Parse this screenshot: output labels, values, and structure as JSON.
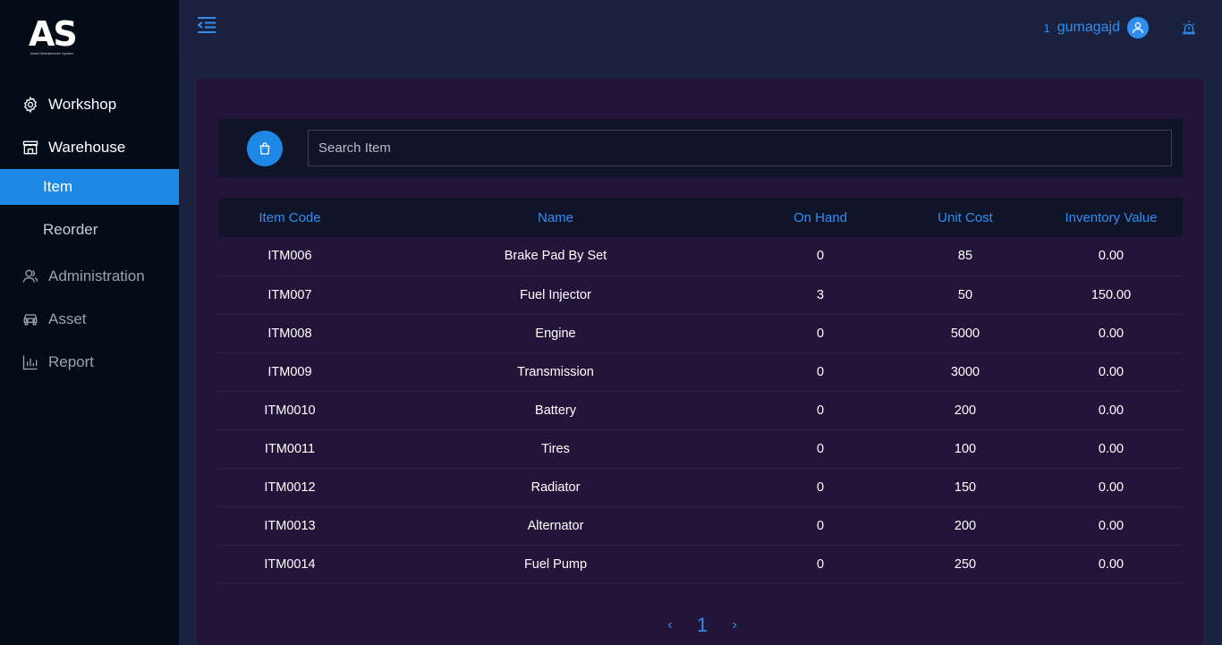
{
  "brand": {
    "logo_text": "AS",
    "tagline": "Asset Maintenance System"
  },
  "sidebar": {
    "items": [
      {
        "label": "Workshop",
        "icon": "gear-icon"
      },
      {
        "label": "Warehouse",
        "icon": "store-icon"
      },
      {
        "label": "Item",
        "sub": true,
        "active": true
      },
      {
        "label": "Reorder",
        "sub": true
      },
      {
        "label": "Administration",
        "icon": "users-icon"
      },
      {
        "label": "Asset",
        "icon": "car-icon"
      },
      {
        "label": "Report",
        "icon": "bar-chart-icon"
      }
    ]
  },
  "topbar": {
    "notification_count": "1",
    "username": "gumagajd",
    "icons": [
      "menu-collapse-icon",
      "user-icon",
      "alarm-icon"
    ]
  },
  "search": {
    "placeholder": "Search Item",
    "value": "",
    "icon": "shopping-bag-icon"
  },
  "table": {
    "headers": [
      "Item Code",
      "Name",
      "On Hand",
      "Unit Cost",
      "Inventory Value"
    ],
    "rows": [
      [
        "ITM006",
        "Brake Pad By Set",
        "0",
        "85",
        "0.00"
      ],
      [
        "ITM007",
        "Fuel Injector",
        "3",
        "50",
        "150.00"
      ],
      [
        "ITM008",
        "Engine",
        "0",
        "5000",
        "0.00"
      ],
      [
        "ITM009",
        "Transmission",
        "0",
        "3000",
        "0.00"
      ],
      [
        "ITM0010",
        "Battery",
        "0",
        "200",
        "0.00"
      ],
      [
        "ITM0011",
        "Tires",
        "0",
        "100",
        "0.00"
      ],
      [
        "ITM0012",
        "Radiator",
        "0",
        "150",
        "0.00"
      ],
      [
        "ITM0013",
        "Alternator",
        "0",
        "200",
        "0.00"
      ],
      [
        "ITM0014",
        "Fuel Pump",
        "0",
        "250",
        "0.00"
      ]
    ]
  },
  "pagination": {
    "prev": "‹",
    "current": "1",
    "next": "›"
  },
  "colors": {
    "accent": "#1e88e5",
    "link": "#2f8ef0",
    "sidebar_bg": "#020d18",
    "panel_bg": "#231539",
    "topbar_bg": "#19213f"
  }
}
